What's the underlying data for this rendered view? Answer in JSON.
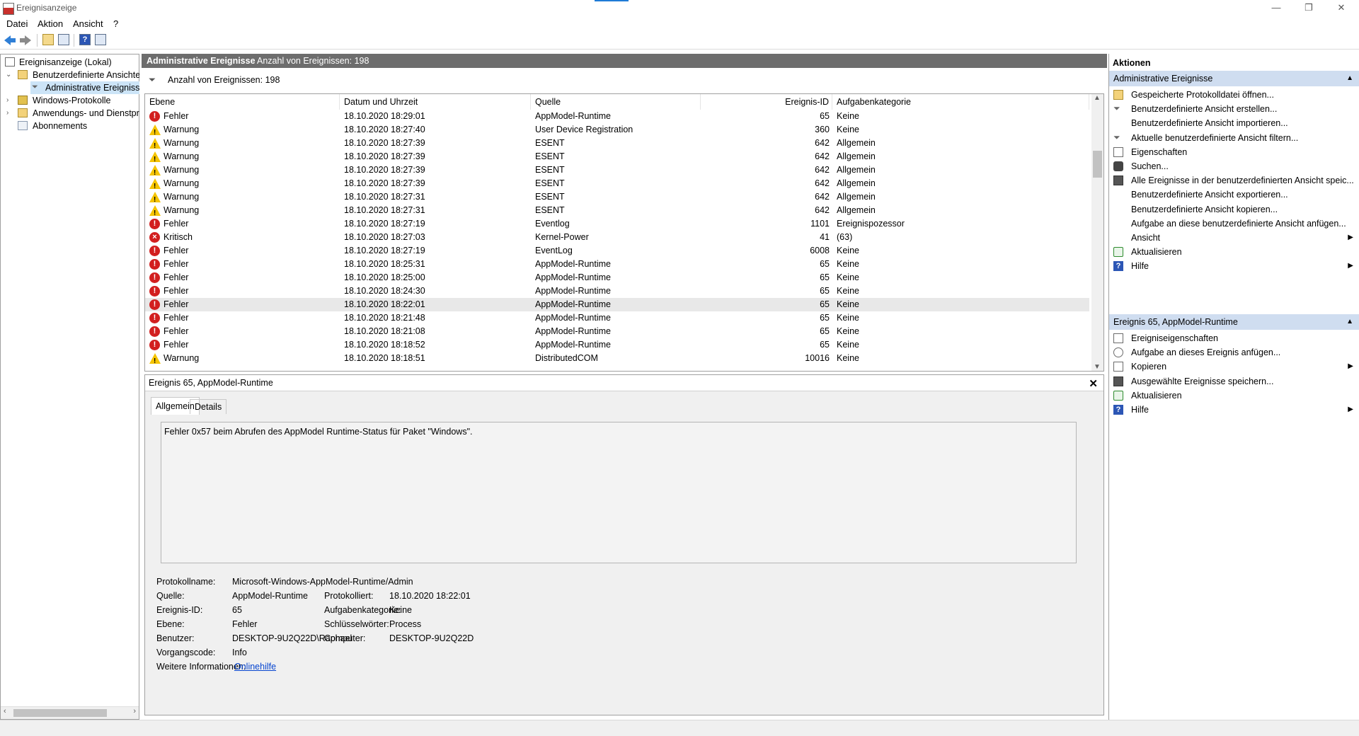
{
  "window": {
    "title": "Ereignisanzeige",
    "minimize": "—",
    "restore": "❐",
    "close": "✕"
  },
  "menu": [
    "Datei",
    "Aktion",
    "Ansicht",
    "?"
  ],
  "tree": {
    "root": "Ereignisanzeige (Lokal)",
    "custom_views": "Benutzerdefinierte Ansichten",
    "admin_events": "Administrative Ereignisse",
    "windows_logs": "Windows-Protokolle",
    "app_logs": "Anwendungs- und Dienstprotokolle",
    "subscriptions": "Abonnements"
  },
  "center": {
    "header_title": "Administrative Ereignisse",
    "header_count": "Anzahl von Ereignissen: 198",
    "filter_text": "Anzahl von Ereignissen: 198",
    "columns": [
      "Ebene",
      "Datum und Uhrzeit",
      "Quelle",
      "Ereignis-ID",
      "Aufgabenkategorie"
    ],
    "rows": [
      {
        "level": "Fehler",
        "type": "error",
        "date": "18.10.2020 18:29:01",
        "source": "AppModel-Runtime",
        "id": "65",
        "category": "Keine"
      },
      {
        "level": "Warnung",
        "type": "warning",
        "date": "18.10.2020 18:27:40",
        "source": "User Device Registration",
        "id": "360",
        "category": "Keine"
      },
      {
        "level": "Warnung",
        "type": "warning",
        "date": "18.10.2020 18:27:39",
        "source": "ESENT",
        "id": "642",
        "category": "Allgemein"
      },
      {
        "level": "Warnung",
        "type": "warning",
        "date": "18.10.2020 18:27:39",
        "source": "ESENT",
        "id": "642",
        "category": "Allgemein"
      },
      {
        "level": "Warnung",
        "type": "warning",
        "date": "18.10.2020 18:27:39",
        "source": "ESENT",
        "id": "642",
        "category": "Allgemein"
      },
      {
        "level": "Warnung",
        "type": "warning",
        "date": "18.10.2020 18:27:39",
        "source": "ESENT",
        "id": "642",
        "category": "Allgemein"
      },
      {
        "level": "Warnung",
        "type": "warning",
        "date": "18.10.2020 18:27:31",
        "source": "ESENT",
        "id": "642",
        "category": "Allgemein"
      },
      {
        "level": "Warnung",
        "type": "warning",
        "date": "18.10.2020 18:27:31",
        "source": "ESENT",
        "id": "642",
        "category": "Allgemein"
      },
      {
        "level": "Fehler",
        "type": "error",
        "date": "18.10.2020 18:27:19",
        "source": "Eventlog",
        "id": "1101",
        "category": "Ereignispozessor"
      },
      {
        "level": "Kritisch",
        "type": "critical",
        "date": "18.10.2020 18:27:03",
        "source": "Kernel-Power",
        "id": "41",
        "category": "(63)"
      },
      {
        "level": "Fehler",
        "type": "error",
        "date": "18.10.2020 18:27:19",
        "source": "EventLog",
        "id": "6008",
        "category": "Keine"
      },
      {
        "level": "Fehler",
        "type": "error",
        "date": "18.10.2020 18:25:31",
        "source": "AppModel-Runtime",
        "id": "65",
        "category": "Keine"
      },
      {
        "level": "Fehler",
        "type": "error",
        "date": "18.10.2020 18:25:00",
        "source": "AppModel-Runtime",
        "id": "65",
        "category": "Keine"
      },
      {
        "level": "Fehler",
        "type": "error",
        "date": "18.10.2020 18:24:30",
        "source": "AppModel-Runtime",
        "id": "65",
        "category": "Keine"
      },
      {
        "level": "Fehler",
        "type": "error",
        "date": "18.10.2020 18:22:01",
        "source": "AppModel-Runtime",
        "id": "65",
        "category": "Keine",
        "selected": true
      },
      {
        "level": "Fehler",
        "type": "error",
        "date": "18.10.2020 18:21:48",
        "source": "AppModel-Runtime",
        "id": "65",
        "category": "Keine"
      },
      {
        "level": "Fehler",
        "type": "error",
        "date": "18.10.2020 18:21:08",
        "source": "AppModel-Runtime",
        "id": "65",
        "category": "Keine"
      },
      {
        "level": "Fehler",
        "type": "error",
        "date": "18.10.2020 18:18:52",
        "source": "AppModel-Runtime",
        "id": "65",
        "category": "Keine"
      },
      {
        "level": "Warnung",
        "type": "warning",
        "date": "18.10.2020 18:18:51",
        "source": "DistributedCOM",
        "id": "10016",
        "category": "Keine"
      }
    ]
  },
  "detail": {
    "title": "Ereignis 65, AppModel-Runtime",
    "tabs": [
      "Allgemein",
      "Details"
    ],
    "description": "Fehler 0x57 beim Abrufen des AppModel Runtime-Status für Paket \"Windows\".",
    "labels": {
      "log_name": "Protokollname:",
      "source": "Quelle:",
      "event_id": "Ereignis-ID:",
      "level": "Ebene:",
      "user": "Benutzer:",
      "opcode": "Vorgangscode:",
      "more_info": "Weitere Informationen:",
      "logged": "Protokolliert:",
      "task_category": "Aufgabenkategorie:",
      "keywords": "Schlüsselwörter:",
      "computer": "Computer:"
    },
    "values": {
      "log_name": "Microsoft-Windows-AppModel-Runtime/Admin",
      "source": "AppModel-Runtime",
      "event_id": "65",
      "level": "Fehler",
      "user": "DESKTOP-9U2Q22D\\Raphael",
      "opcode": "Info",
      "more_info": "Onlinehilfe",
      "logged": "18.10.2020 18:22:01",
      "task_category": "Keine",
      "keywords": "Process",
      "computer": "DESKTOP-9U2Q22D"
    }
  },
  "actions": {
    "header": "Aktionen",
    "section1": "Administrative Ereignisse",
    "items1": [
      {
        "label": "Gespeicherte Protokolldatei öffnen...",
        "icon": "folder-open-icon"
      },
      {
        "label": "Benutzerdefinierte Ansicht erstellen...",
        "icon": "filter-icon"
      },
      {
        "label": "Benutzerdefinierte Ansicht importieren...",
        "icon": ""
      },
      {
        "label": "Aktuelle benutzerdefinierte Ansicht filtern...",
        "icon": "filter-icon"
      },
      {
        "label": "Eigenschaften",
        "icon": "properties-icon"
      },
      {
        "label": "Suchen...",
        "icon": "binoculars-icon"
      },
      {
        "label": "Alle Ereignisse in der benutzerdefinierten Ansicht speic...",
        "icon": "save-icon"
      },
      {
        "label": "Benutzerdefinierte Ansicht exportieren...",
        "icon": ""
      },
      {
        "label": "Benutzerdefinierte Ansicht kopieren...",
        "icon": ""
      },
      {
        "label": "Aufgabe an diese benutzerdefinierte Ansicht anfügen...",
        "icon": ""
      },
      {
        "label": "Ansicht",
        "icon": "",
        "submenu": true
      },
      {
        "label": "Aktualisieren",
        "icon": "refresh-icon"
      },
      {
        "label": "Hilfe",
        "icon": "help-icon",
        "submenu": true
      }
    ],
    "section2": "Ereignis 65, AppModel-Runtime",
    "items2": [
      {
        "label": "Ereigniseigenschaften",
        "icon": "properties-icon"
      },
      {
        "label": "Aufgabe an dieses Ereignis anfügen...",
        "icon": "task-icon"
      },
      {
        "label": "Kopieren",
        "icon": "copy-icon",
        "submenu": true
      },
      {
        "label": "Ausgewählte Ereignisse speichern...",
        "icon": "save-icon"
      },
      {
        "label": "Aktualisieren",
        "icon": "refresh-icon"
      },
      {
        "label": "Hilfe",
        "icon": "help-icon",
        "submenu": true
      }
    ]
  },
  "colors": {
    "error": "#d21f1f",
    "warning": "#f5c400",
    "section_bg": "#cfddf0",
    "header_bg": "#6d6d6d",
    "link": "#0645d0"
  }
}
